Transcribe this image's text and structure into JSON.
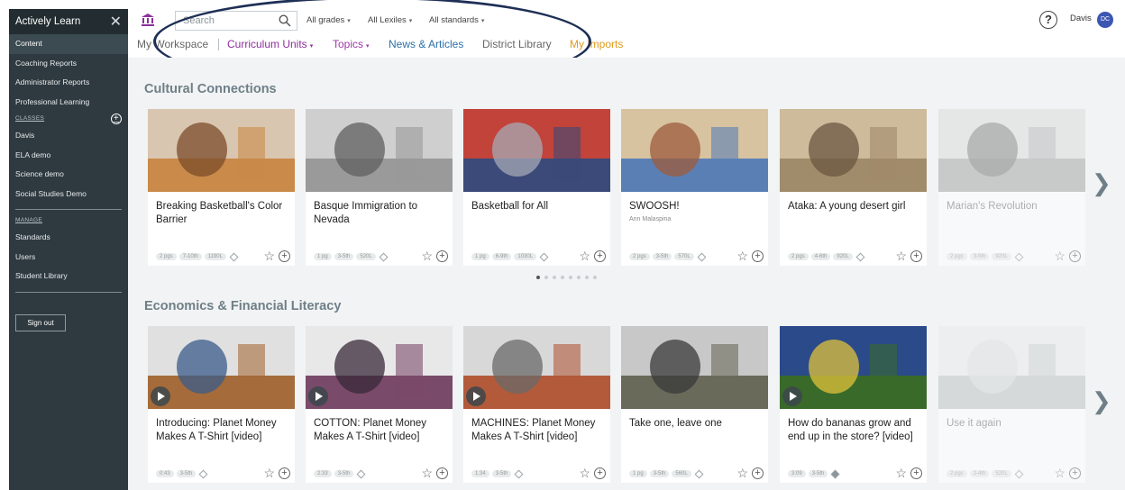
{
  "sidebar": {
    "brand": "Actively Learn",
    "items_top": [
      "Content",
      "Coaching Reports",
      "Administrator Reports",
      "Professional Learning"
    ],
    "classes_header": "CLASSES",
    "classes": [
      "Davis",
      "ELA demo",
      "Science demo",
      "Social Studies Demo"
    ],
    "manage_header": "MANAGE",
    "manage": [
      "Standards",
      "Users",
      "Student Library"
    ],
    "sign_out": "Sign out"
  },
  "header": {
    "search_placeholder": "Search",
    "filters": [
      "All grades",
      "All Lexiles",
      "All standards"
    ],
    "user_name": "Davis",
    "user_initials": "DC",
    "nav": [
      "My Workspace",
      "Curriculum Units",
      "Topics",
      "News & Articles",
      "District Library",
      "My Imports"
    ]
  },
  "colors": {
    "nav_workspace": "#666666",
    "nav_units": "#8c2f9b",
    "nav_topics": "#9c3aa8",
    "nav_news": "#2d6fa8",
    "nav_library": "#666666",
    "nav_imports": "#e09a1c",
    "sidebar_bg": "#2e3a40",
    "annotation": "#1e2f56"
  },
  "sections": [
    {
      "title": "Cultural Connections",
      "cards": [
        {
          "title": "Breaking Basketball's Color Barrier",
          "sub": "",
          "meta": [
            "2 pgs",
            "7-10th",
            "1190L"
          ],
          "video": false,
          "faded": false
        },
        {
          "title": "Basque Immigration to Nevada",
          "sub": "",
          "meta": [
            "1 pg",
            "3-5th",
            "520L"
          ],
          "video": false,
          "faded": false
        },
        {
          "title": "Basketball for All",
          "sub": "",
          "meta": [
            "1 pg",
            "6-9th",
            "1030L"
          ],
          "video": false,
          "faded": false
        },
        {
          "title": "SWOOSH!",
          "sub": "Ann Malaspina",
          "meta": [
            "2 pgs",
            "3-5th",
            "570L"
          ],
          "video": false,
          "faded": false
        },
        {
          "title": "Ataka: A young desert girl",
          "sub": "",
          "meta": [
            "2 pgs",
            "4-6th",
            "920L"
          ],
          "video": false,
          "faded": false
        },
        {
          "title": "Marian's Revolution",
          "sub": "",
          "meta": [
            "2 pgs",
            "3-5th",
            "920L"
          ],
          "video": false,
          "faded": true
        }
      ]
    },
    {
      "title": "Economics & Financial Literacy",
      "cards": [
        {
          "title": "Introducing: Planet Money Makes A T-Shirt [video]",
          "sub": "",
          "meta": [
            "0:43",
            "3-5th"
          ],
          "video": true,
          "faded": false
        },
        {
          "title": "COTTON: Planet Money Makes A T-Shirt [video]",
          "sub": "",
          "meta": [
            "2:33",
            "3-5th"
          ],
          "video": true,
          "faded": false
        },
        {
          "title": "MACHINES: Planet Money Makes A T-Shirt [video]",
          "sub": "",
          "meta": [
            "1:34",
            "3-5th"
          ],
          "video": true,
          "faded": false
        },
        {
          "title": "Take one, leave one",
          "sub": "",
          "meta": [
            "1 pg",
            "3-5th",
            "560L"
          ],
          "video": false,
          "faded": false
        },
        {
          "title": "How do bananas grow and end up in the store? [video]",
          "sub": "",
          "meta": [
            "3:09",
            "3-5th"
          ],
          "video": true,
          "faded": false
        },
        {
          "title": "Use it again",
          "sub": "",
          "meta": [
            "2 pgs",
            "2-4th",
            "520L"
          ],
          "video": false,
          "faded": true
        }
      ]
    }
  ],
  "icons": {
    "home": "museum-icon",
    "search": "search-icon",
    "help": "help-icon",
    "close": "close-icon",
    "next": "chevron-right-icon"
  },
  "carousel": {
    "dot_count": 8,
    "active_index": 0
  }
}
